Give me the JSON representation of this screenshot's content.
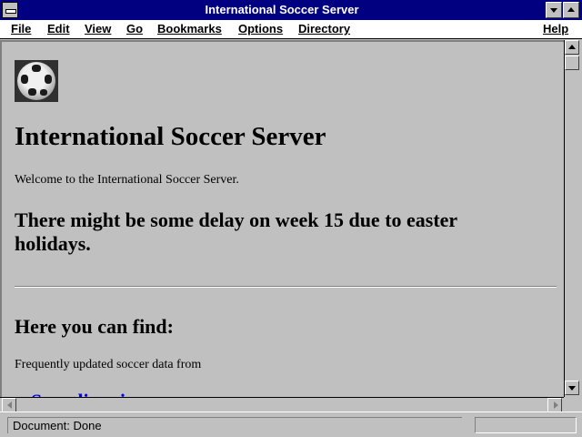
{
  "window": {
    "title": "International Soccer Server"
  },
  "menu": {
    "file": "File",
    "edit": "Edit",
    "view": "View",
    "go": "Go",
    "bookmarks": "Bookmarks",
    "options": "Options",
    "directory": "Directory",
    "help": "Help"
  },
  "page": {
    "heading": "International Soccer Server",
    "welcome": "Welcome to the International Soccer Server.",
    "notice": "There might be some delay on week 15 due to easter holidays.",
    "find_heading": "Here you can find:",
    "intro": "Frequently updated soccer data from",
    "link_fragment": "Scandinavia"
  },
  "status": {
    "text": "Document: Done"
  },
  "colors": {
    "titlebar": "#000080",
    "background": "#c0c0c0",
    "link": "#0000ff"
  },
  "icons": {
    "logo": "soccer-ball-icon"
  }
}
